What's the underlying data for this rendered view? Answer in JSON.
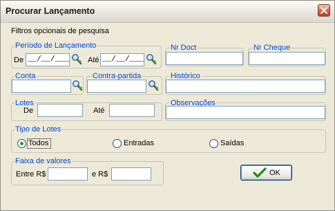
{
  "window": {
    "title": "Procurar Lançamento"
  },
  "filters_label": "Filtros opcionais de pesquisa",
  "periodo": {
    "legend": "Período de Lançamento",
    "de_label": "De",
    "de_value": "__/__/____",
    "ate_label": "Até",
    "ate_value": "__/__/____"
  },
  "nr_doct": {
    "legend": "Nr Doct",
    "value": ""
  },
  "nr_cheque": {
    "legend": "Nr Cheque",
    "value": ""
  },
  "conta": {
    "legend": "Conta",
    "value": ""
  },
  "contra_partida": {
    "legend": "Contra-partida",
    "value": ""
  },
  "historico": {
    "legend": "Histórico",
    "value": ""
  },
  "lotes": {
    "legend": "Lotes",
    "de_label": "De",
    "de_value": "",
    "ate_label": "Até",
    "ate_value": ""
  },
  "observacoes": {
    "legend": "Observações",
    "value": ""
  },
  "tipo_lotes": {
    "legend": "Tipo de Lotes",
    "options": [
      "Todos",
      "Entradas",
      "Saídas"
    ],
    "selected": "Todos"
  },
  "faixa_valores": {
    "legend": "Faixa de valores",
    "entre_label": "Entre R$",
    "entre_value": "",
    "e_label": "e R$",
    "e_value": ""
  },
  "ok_button": {
    "label": "OK"
  },
  "colors": {
    "legend": "#0046d5",
    "accent": "#003c74",
    "radio_dot": "#21a121"
  },
  "icons": [
    "close-icon",
    "search-icon",
    "check-icon"
  ]
}
